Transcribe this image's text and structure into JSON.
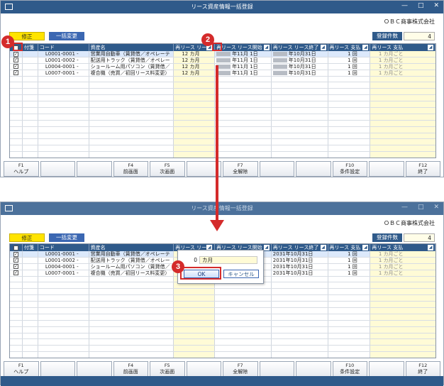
{
  "window": {
    "title": "リース資産情報一括登録",
    "controls": [
      "—",
      "□",
      "✕"
    ],
    "company": "ＯＢＣ商事株式会社"
  },
  "toolbar": {
    "edit_label": "修正",
    "bulk_label": "一括変更",
    "count_label": "登録件数",
    "count_value": "4"
  },
  "table": {
    "headers": [
      "",
      "付箋",
      "コード",
      "資産名",
      "再リース リー",
      "再リース リース開始",
      "再リース リース終了",
      "再リース 支払",
      "再リース 支払"
    ],
    "rows": [
      {
        "code": "L0001-0001 -",
        "name": "営業用自動車（賃貸借／オペレーテ",
        "months": "12",
        "month_unit": "カ月",
        "start": "年11月 1日",
        "end": "年10月31日",
        "start2": "",
        "end2": "2031年10月31日",
        "amt": "1",
        "amt_unit": "回",
        "pay": "1",
        "pay_unit": "カ月ごと"
      },
      {
        "code": "L0001-0002 -",
        "name": "配送用トラック（賃貸借／オペレー",
        "months": "12",
        "month_unit": "カ月",
        "start": "年11月 1日",
        "end": "年10月31日",
        "start2": "",
        "end2": "2031年10月31日",
        "amt": "1",
        "amt_unit": "回",
        "pay": "1",
        "pay_unit": "カ月ごと"
      },
      {
        "code": "L0004-0001 -",
        "name": "ショールーム用パソコン（賃貸借／",
        "months": "12",
        "month_unit": "カ月",
        "start": "年11月 1日",
        "end": "年10月31日",
        "start2": "",
        "end2": "2031年10月31日",
        "amt": "1",
        "amt_unit": "回",
        "pay": "1",
        "pay_unit": "カ月ごと"
      },
      {
        "code": "L0007-0001 -",
        "name": "複合機（売買／初回リース料変更）",
        "months": "12",
        "month_unit": "カ月",
        "start": "年11月 1日",
        "end": "年10月31日",
        "start2": "",
        "end2": "2031年10月31日",
        "amt": "1",
        "amt_unit": "回",
        "pay": "1",
        "pay_unit": "カ月ごと"
      }
    ]
  },
  "fkeys": [
    {
      "key": "F1",
      "label": "ヘルプ"
    },
    {
      "key": "",
      "label": ""
    },
    {
      "key": "",
      "label": ""
    },
    {
      "key": "F4",
      "label": "前画面"
    },
    {
      "key": "F5",
      "label": "次画面"
    },
    {
      "key": "",
      "label": ""
    },
    {
      "key": "F7",
      "label": "全解除"
    },
    {
      "key": "",
      "label": ""
    },
    {
      "key": "",
      "label": ""
    },
    {
      "key": "F10",
      "label": "条件設定"
    },
    {
      "key": "",
      "label": ""
    },
    {
      "key": "F12",
      "label": "終了"
    }
  ],
  "popup": {
    "value": "0",
    "unit": "カ月",
    "ok": "OK",
    "cancel": "キャンセル"
  },
  "annotations": {
    "step1": "1",
    "step2": "2",
    "step3": "3",
    "accent": "#d42b2b"
  }
}
